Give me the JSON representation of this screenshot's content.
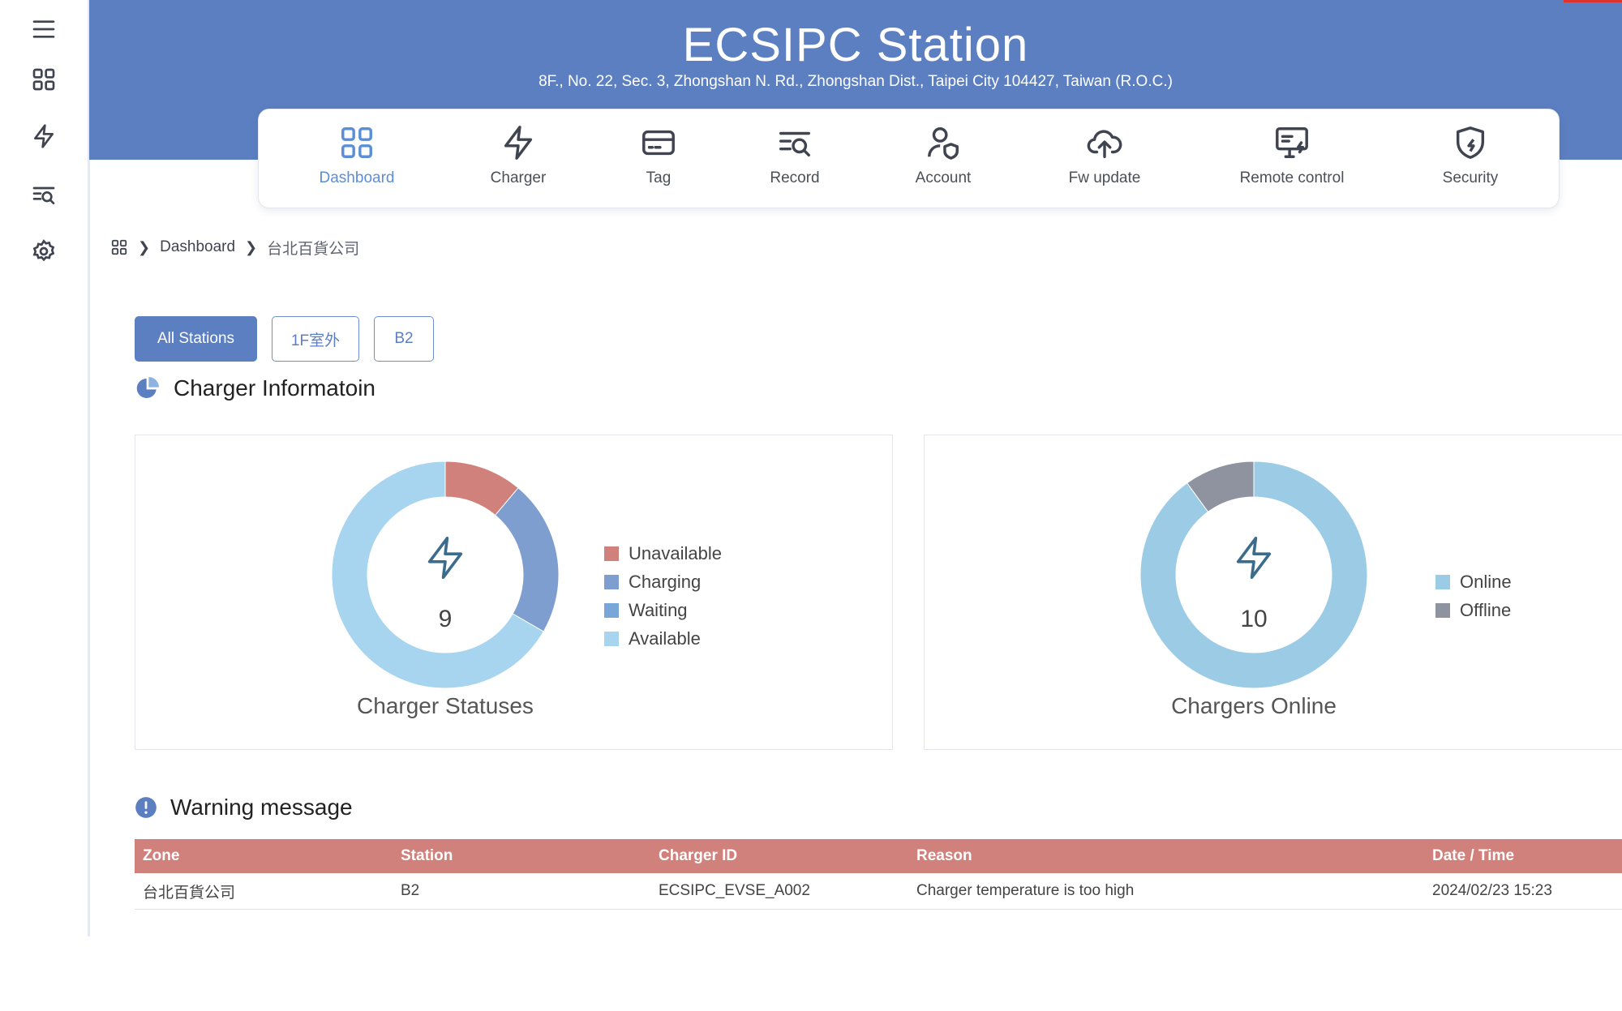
{
  "header": {
    "title": "ECSIPC Station",
    "address": "8F., No. 22, Sec. 3, Zhongshan N. Rd., Zhongshan Dist., Taipei City 104427, Taiwan (R.O.C.)"
  },
  "rail": {
    "icons": [
      "menu-icon",
      "dashboard-grid-icon",
      "lightning-icon",
      "record-search-icon",
      "settings-gear-icon"
    ]
  },
  "nav": {
    "active": "Dashboard",
    "items": [
      {
        "label": "Dashboard",
        "icon": "dashboard-grid-icon"
      },
      {
        "label": "Charger",
        "icon": "lightning-icon"
      },
      {
        "label": "Tag",
        "icon": "card-icon"
      },
      {
        "label": "Record",
        "icon": "record-search-icon"
      },
      {
        "label": "Account",
        "icon": "user-shield-icon"
      },
      {
        "label": "Fw update",
        "icon": "cloud-upload-icon"
      },
      {
        "label": "Remote control",
        "icon": "monitor-lightning-icon"
      },
      {
        "label": "Security",
        "icon": "shield-lightning-icon"
      }
    ]
  },
  "breadcrumb": {
    "icon": "dashboard-grid-icon",
    "items": [
      "Dashboard",
      "台北百貨公司"
    ]
  },
  "stations": {
    "active": "All Stations",
    "tabs": [
      "All Stations",
      "1F室外",
      "B2"
    ]
  },
  "charger_info": {
    "title": "Charger Informatoin",
    "icon": "pie-chart-icon"
  },
  "colors": {
    "header": "#5b7fc1",
    "unavailable": "#d0817c",
    "charging": "#7f9ed0",
    "waiting": "#79a6d9",
    "available": "#a7d4ef",
    "online": "#9ccbe6",
    "offline": "#8e939f",
    "table_header": "#d0817c"
  },
  "chart_data": [
    {
      "type": "pie",
      "title": "Charger Statuses",
      "center_value": "9",
      "center_icon": "lightning-icon",
      "series": [
        {
          "name": "Unavailable",
          "value": 1
        },
        {
          "name": "Charging",
          "value": 2
        },
        {
          "name": "Waiting",
          "value": 0
        },
        {
          "name": "Available",
          "value": 6
        }
      ],
      "legend": "right"
    },
    {
      "type": "pie",
      "title": "Chargers Online",
      "center_value": "10",
      "center_icon": "lightning-icon",
      "series": [
        {
          "name": "Online",
          "value": 9
        },
        {
          "name": "Offline",
          "value": 1
        }
      ],
      "legend": "right"
    }
  ],
  "warning": {
    "title": "Warning message",
    "icon": "exclamation-circle-icon",
    "columns": [
      "Zone",
      "Station",
      "Charger ID",
      "Reason",
      "Date / Time"
    ],
    "rows": [
      [
        "台北百貨公司",
        "B2",
        "ECSIPC_EVSE_A002",
        "Charger temperature is too high",
        "2024/02/23 15:23"
      ]
    ]
  }
}
